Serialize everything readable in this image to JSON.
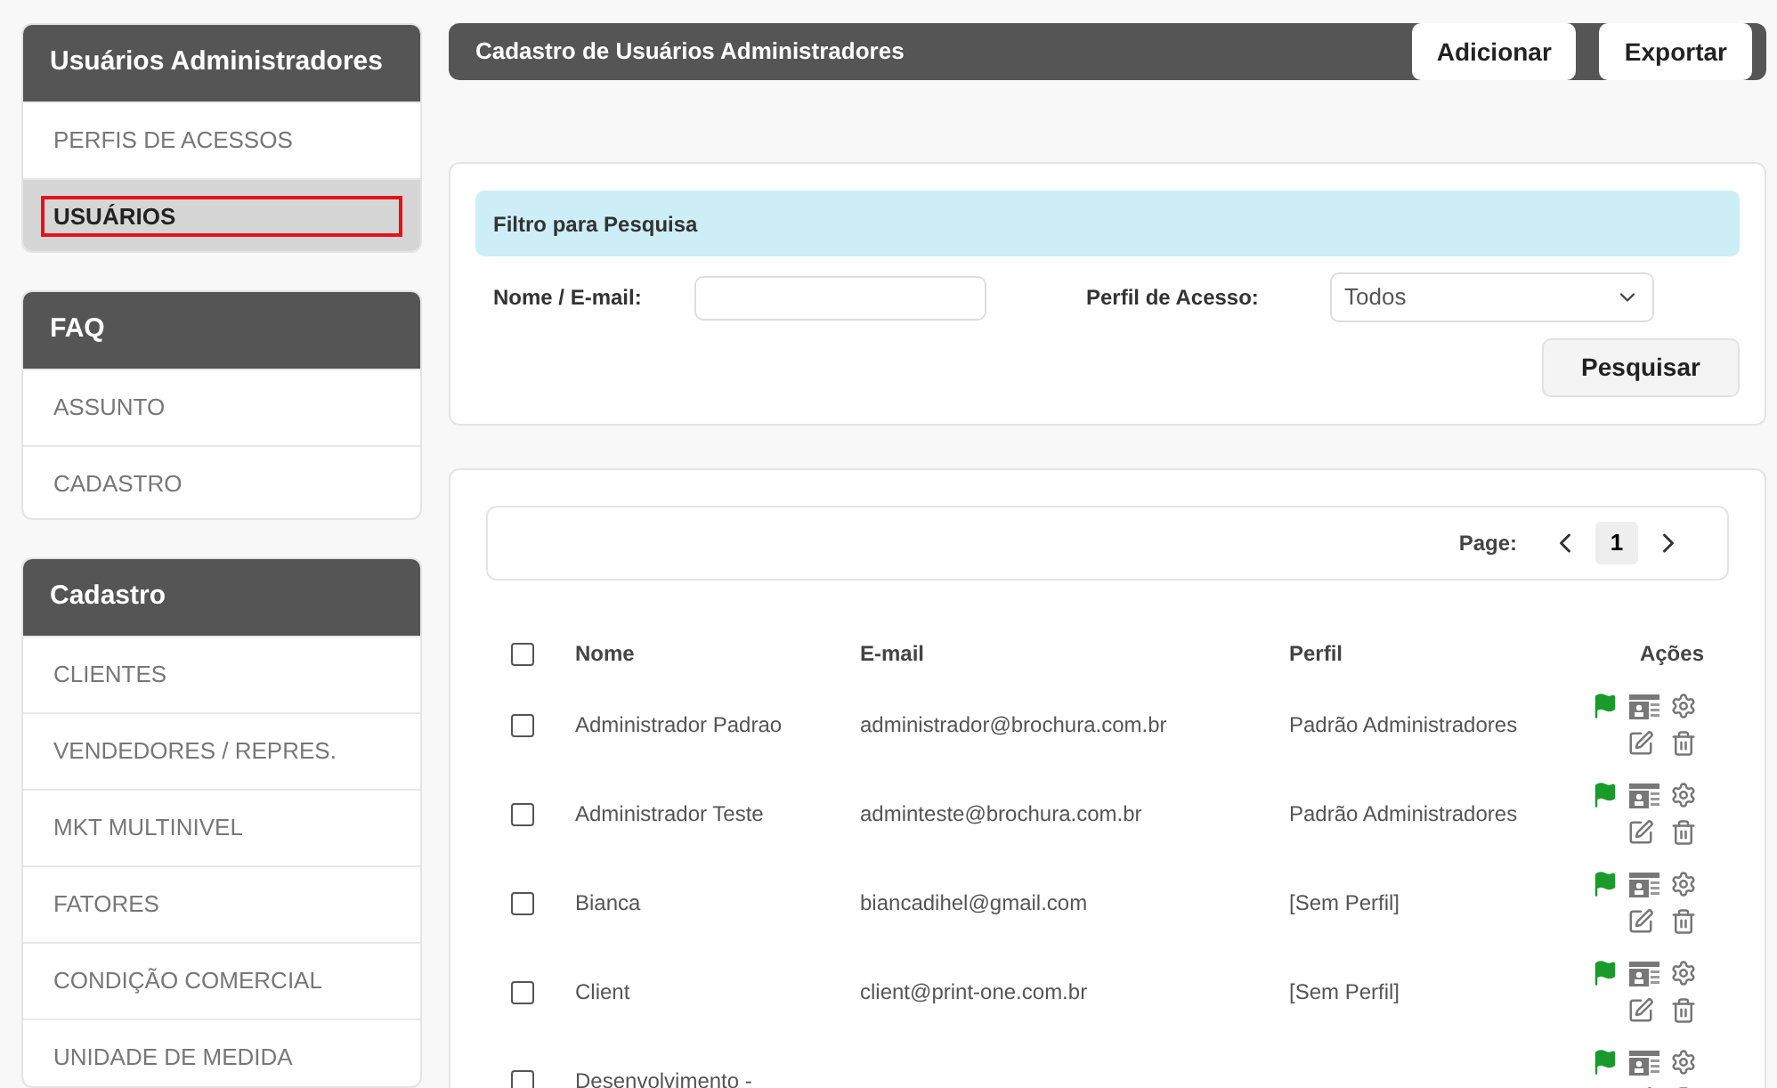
{
  "sidebar": [
    {
      "title": "Usuários Administradores",
      "items": [
        {
          "label": "PERFIS DE ACESSOS",
          "selected": false
        },
        {
          "label": "USUÁRIOS",
          "selected": true
        }
      ]
    },
    {
      "title": "FAQ",
      "items": [
        {
          "label": "ASSUNTO",
          "selected": false
        },
        {
          "label": "CADASTRO",
          "selected": false
        }
      ]
    },
    {
      "title": "Cadastro",
      "items": [
        {
          "label": "CLIENTES",
          "selected": false
        },
        {
          "label": "VENDEDORES / REPRES.",
          "selected": false
        },
        {
          "label": "MKT MULTINIVEL",
          "selected": false
        },
        {
          "label": "FATORES",
          "selected": false
        },
        {
          "label": "CONDIÇÃO COMERCIAL",
          "selected": false
        },
        {
          "label": "UNIDADE DE MEDIDA",
          "selected": false
        }
      ]
    }
  ],
  "header": {
    "title": "Cadastro de Usuários Administradores",
    "buttons": [
      "Adicionar",
      "Exportar"
    ]
  },
  "filter": {
    "title": "Filtro para Pesquisa",
    "name_label": "Nome / E-mail:",
    "profile_label": "Perfil de Acesso:",
    "profile_value": "Todos",
    "search_button": "Pesquisar"
  },
  "pagination": {
    "label": "Page:",
    "current": "1"
  },
  "table": {
    "columns": [
      "Nome",
      "E-mail",
      "Perfil",
      "Ações"
    ],
    "header_checked": false,
    "rows": [
      {
        "checked": false,
        "name": "Administrador Padrao",
        "email": "administrador@brochura.com.br",
        "profile": "Padrão Administradores"
      },
      {
        "checked": false,
        "name": "Administrador Teste",
        "email": "adminteste@brochura.com.br",
        "profile": "Padrão Administradores"
      },
      {
        "checked": false,
        "name": "Bianca",
        "email": "biancadihel@gmail.com",
        "profile": "[Sem Perfil]"
      },
      {
        "checked": false,
        "name": "Client",
        "email": "client@print-one.com.br",
        "profile": "[Sem Perfil]"
      },
      {
        "checked": false,
        "name": "Desenvolvimento -",
        "email": "",
        "profile": ""
      }
    ]
  }
}
